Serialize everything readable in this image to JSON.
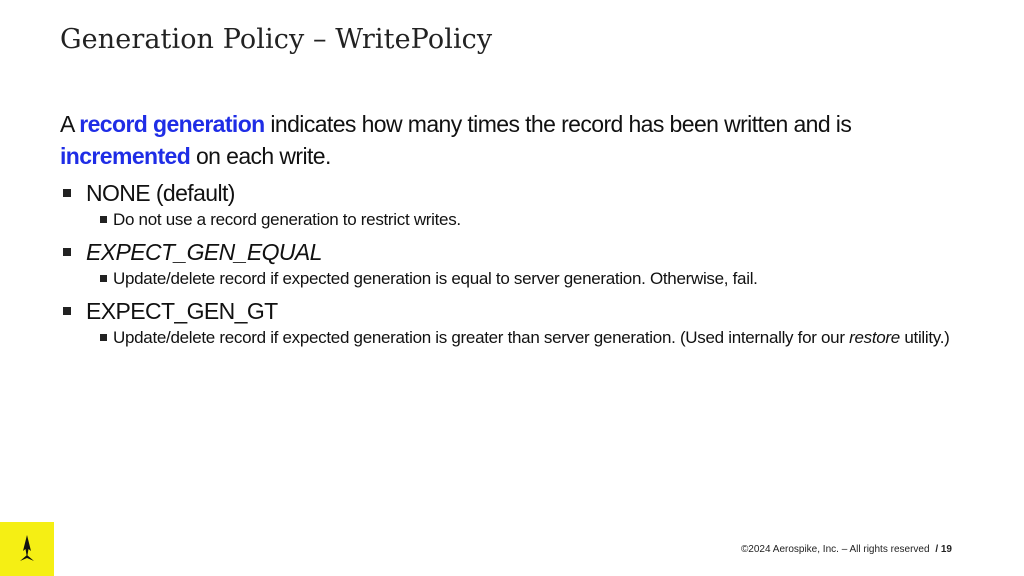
{
  "slide": {
    "title": "Generation Policy – WritePolicy",
    "intro": {
      "part1": "A ",
      "highlight1": "record generation",
      "part2": " indicates how many times the record has been written and is ",
      "highlight2": "incremented",
      "part3": " on each write."
    },
    "items": [
      {
        "label": "NONE (default)",
        "detail": "Do not use a record generation to restrict writes."
      },
      {
        "label": "EXPECT_GEN_EQUAL",
        "detail": "Update/delete record if expected generation is equal to server generation. Otherwise, fail."
      },
      {
        "label": "EXPECT_GEN_GT",
        "detail_part1": "Update/delete record if expected generation is greater than server generation. (Used internally for our ",
        "detail_italic": "restore",
        "detail_part2": " utility.)"
      }
    ],
    "footer": {
      "copyright": "©2024 Aerospike, Inc. – All rights reserved",
      "page": "/ 19"
    },
    "colors": {
      "highlight": "#1f2de6",
      "logo_background": "#f5ef14"
    },
    "logo_icon": "aerospike-rocket-icon"
  }
}
